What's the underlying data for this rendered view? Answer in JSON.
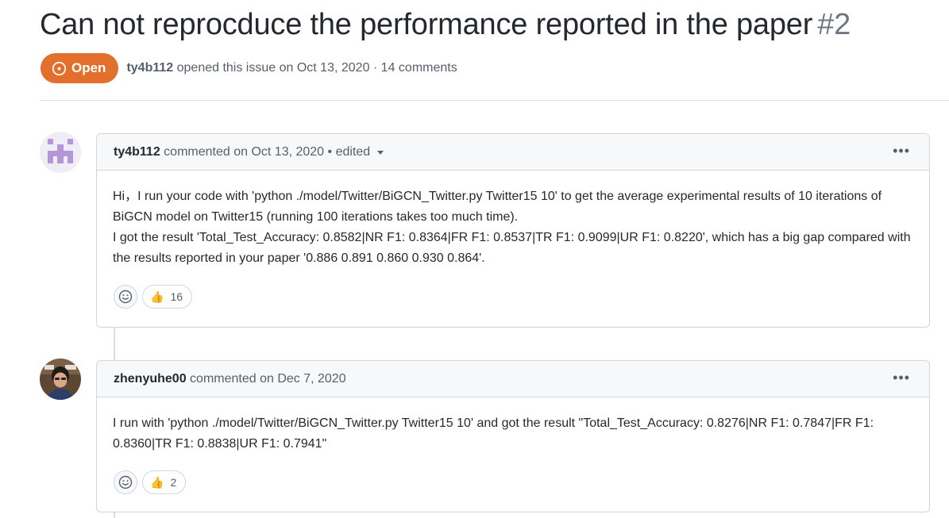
{
  "issue": {
    "title": "Can not reprocduce the performance reported in the paper",
    "number": "#2",
    "state": "Open",
    "state_color": "#e36f2d",
    "author": "ty4b112",
    "opened_text": "opened this issue on Oct 13, 2020 · 14 comments"
  },
  "comments": [
    {
      "author": "ty4b112",
      "meta": "commented on Oct 13, 2020 • edited",
      "avatar_icon": "identicon-avatar",
      "paragraphs": [
        "Hi，I run your code with 'python ./model/Twitter/BiGCN_Twitter.py Twitter15 10' to get the average experimental results of 10 iterations of BiGCN model on Twitter15 (running 100 iterations takes too much time).",
        "I got the result 'Total_Test_Accuracy: 0.8582|NR F1: 0.8364|FR F1: 0.8537|TR F1: 0.9099|UR F1: 0.8220', which has a big gap compared with the results reported in your paper '0.886 0.891 0.860 0.930 0.864'."
      ],
      "reaction": {
        "emoji": "👍",
        "count": "16"
      }
    },
    {
      "author": "zhenyuhe00",
      "meta": "commented on Dec 7, 2020",
      "avatar_icon": "user-photo-avatar",
      "paragraphs": [
        "I run with 'python ./model/Twitter/BiGCN_Twitter.py Twitter15 10' and got the result \"Total_Test_Accuracy: 0.8276|NR F1: 0.7847|FR F1: 0.8360|TR F1: 0.8838|UR F1: 0.7941\""
      ],
      "reaction": {
        "emoji": "👍",
        "count": "2"
      }
    }
  ]
}
